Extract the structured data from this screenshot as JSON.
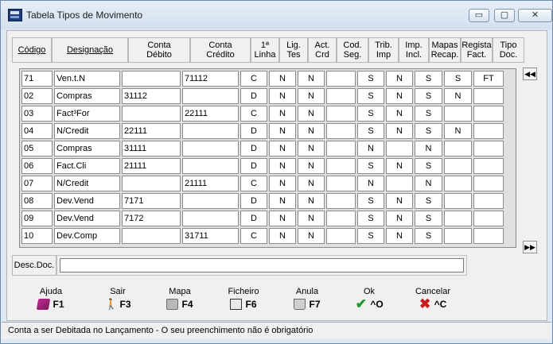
{
  "window": {
    "title": "Tabela Tipos de Movimento",
    "minimize_icon": "minimize-icon",
    "maximize_icon": "maximize-icon",
    "close_icon": "close-icon",
    "min_glyph": "▭",
    "max_glyph": "▢",
    "close_glyph": "✕"
  },
  "table": {
    "headers": [
      {
        "label": "Código",
        "underline": true
      },
      {
        "label": "Designação",
        "underline": true
      },
      {
        "label": "Conta\nDébito"
      },
      {
        "label": "Conta\nCrédito"
      },
      {
        "label": "1ª\nLinha"
      },
      {
        "label": "Lig.\nTes"
      },
      {
        "label": "Act.\nCrd"
      },
      {
        "label": "Cod.\nSeg."
      },
      {
        "label": "Trib.\nImp"
      },
      {
        "label": "Imp.\nIncl."
      },
      {
        "label": "Mapas\nRecap."
      },
      {
        "label": "Regista\nFact."
      },
      {
        "label": "Tipo\nDoc."
      }
    ],
    "rows": [
      [
        "71",
        "Ven.t.N",
        "",
        "71112",
        "C",
        "N",
        "N",
        "",
        "S",
        "N",
        "S",
        "S",
        "FT"
      ],
      [
        "02",
        "Compras",
        "31112",
        "",
        "D",
        "N",
        "N",
        "",
        "S",
        "N",
        "S",
        "N",
        ""
      ],
      [
        "03",
        "Fact³For",
        "",
        "22111",
        "C",
        "N",
        "N",
        "",
        "S",
        "N",
        "S",
        "",
        ""
      ],
      [
        "04",
        "N/Credit",
        "22111",
        "",
        "D",
        "N",
        "N",
        "",
        "S",
        "N",
        "S",
        "N",
        ""
      ],
      [
        "05",
        "Compras",
        "31111",
        "",
        "D",
        "N",
        "N",
        "",
        "N",
        "",
        "N",
        "",
        ""
      ],
      [
        "06",
        "Fact.Cli",
        "21111",
        "",
        "D",
        "N",
        "N",
        "",
        "S",
        "N",
        "S",
        "",
        ""
      ],
      [
        "07",
        "N/Credit",
        "",
        "21111",
        "C",
        "N",
        "N",
        "",
        "N",
        "",
        "N",
        "",
        ""
      ],
      [
        "08",
        "Dev.Vend",
        "7171",
        "",
        "D",
        "N",
        "N",
        "",
        "S",
        "N",
        "S",
        "",
        ""
      ],
      [
        "09",
        "Dev.Vend",
        "7172",
        "",
        "D",
        "N",
        "N",
        "",
        "S",
        "N",
        "S",
        "",
        ""
      ],
      [
        "10",
        "Dev.Comp",
        "",
        "31711",
        "C",
        "N",
        "N",
        "",
        "S",
        "N",
        "S",
        "",
        ""
      ]
    ],
    "scroll_up_glyph": "◀◀",
    "scroll_down_glyph": "▶▶"
  },
  "desc": {
    "label": "Desc.Doc.",
    "value": ""
  },
  "function_keys": [
    {
      "label": "Ajuda",
      "key": "F1",
      "icon": "help-book-icon"
    },
    {
      "label": "Sair",
      "key": "F3",
      "icon": "exit-person-icon"
    },
    {
      "label": "Mapa",
      "key": "F4",
      "icon": "printer-icon"
    },
    {
      "label": "Ficheiro",
      "key": "F6",
      "icon": "file-cabinet-icon"
    },
    {
      "label": "Anula",
      "key": "F7",
      "icon": "trash-icon"
    },
    {
      "label": "Ok",
      "key": "^O",
      "icon": "checkmark-icon"
    },
    {
      "label": "Cancelar",
      "key": "^C",
      "icon": "cancel-x-icon"
    }
  ],
  "status": {
    "text": "Conta a ser Debitada no Lançamento - O seu preenchimento não é obrigatório"
  },
  "colors": {
    "ok": "#1e9b2a",
    "cancel": "#c81c1c"
  }
}
